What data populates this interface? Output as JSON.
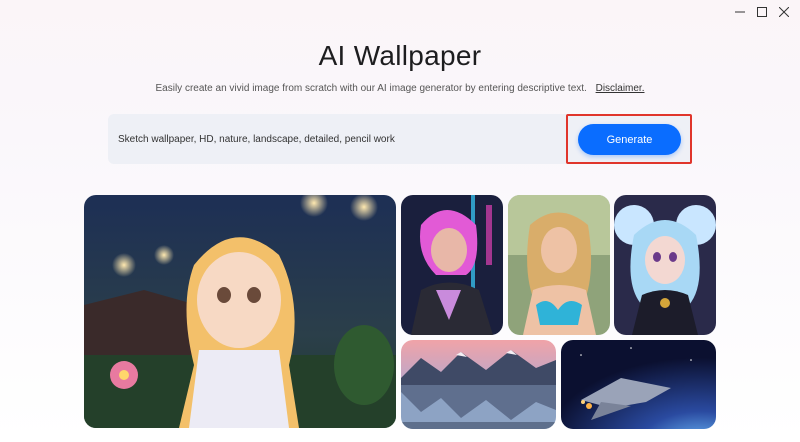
{
  "window": {
    "controls": [
      "minimize",
      "maximize",
      "close"
    ]
  },
  "header": {
    "title": "AI Wallpaper"
  },
  "subtitle": {
    "text": "Easily create an vivid image from scratch with our AI image generator by entering descriptive text.",
    "disclaimer_label": "Disclaimer."
  },
  "prompt": {
    "value": "Sketch wallpaper, HD, nature, landscape, detailed, pencil work",
    "generate_label": "Generate"
  },
  "gallery": {
    "items": [
      {
        "name": "anime-girl-garden",
        "alt": ""
      },
      {
        "name": "pink-hair-woman-neon",
        "alt": ""
      },
      {
        "name": "blonde-woman-beach",
        "alt": ""
      },
      {
        "name": "anime-girl-blue-hair",
        "alt": ""
      },
      {
        "name": "mountain-lake",
        "alt": ""
      },
      {
        "name": "spaceship-planet",
        "alt": ""
      }
    ]
  },
  "colors": {
    "accent": "#0a6dff",
    "highlight": "#e0352b",
    "input_bg": "#eef0f6"
  }
}
